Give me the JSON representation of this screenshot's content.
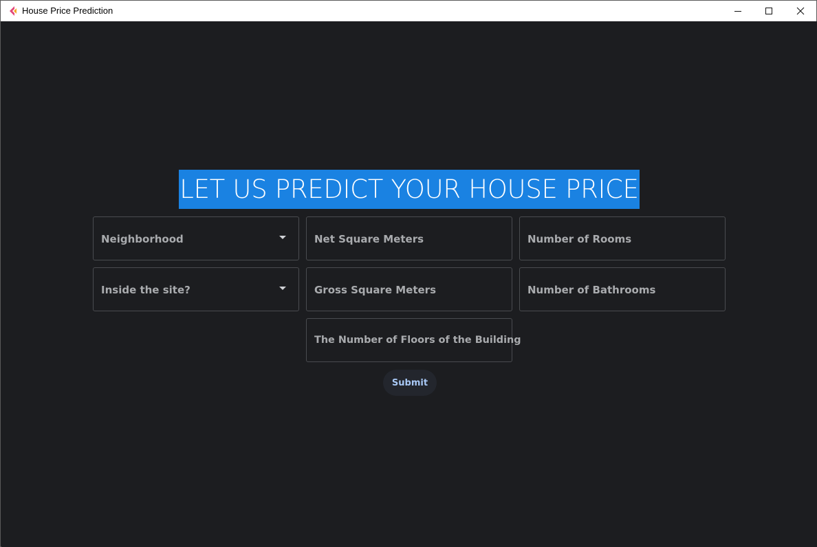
{
  "window": {
    "title": "House Price Prediction",
    "logo_colors": [
      "#e2487a",
      "#f5a623"
    ]
  },
  "main": {
    "heading": "LET US PREDICT YOUR HOUSE PRICE",
    "heading_highlight_color": "#1a82e2",
    "fields": {
      "neighborhood": "Neighborhood",
      "net_sqm": "Net Square Meters",
      "rooms": "Number of Rooms",
      "inside_site": "Inside the site?",
      "gross_sqm": "Gross Square Meters",
      "bathrooms": "Number of Bathrooms",
      "floors": "The Number of Floors of the Building"
    },
    "submit_label": "Submit"
  },
  "colors": {
    "background": "#1c1d20",
    "field_border": "#4a4c50",
    "label_text": "#a9abae",
    "submit_text": "#a8c8f5"
  }
}
